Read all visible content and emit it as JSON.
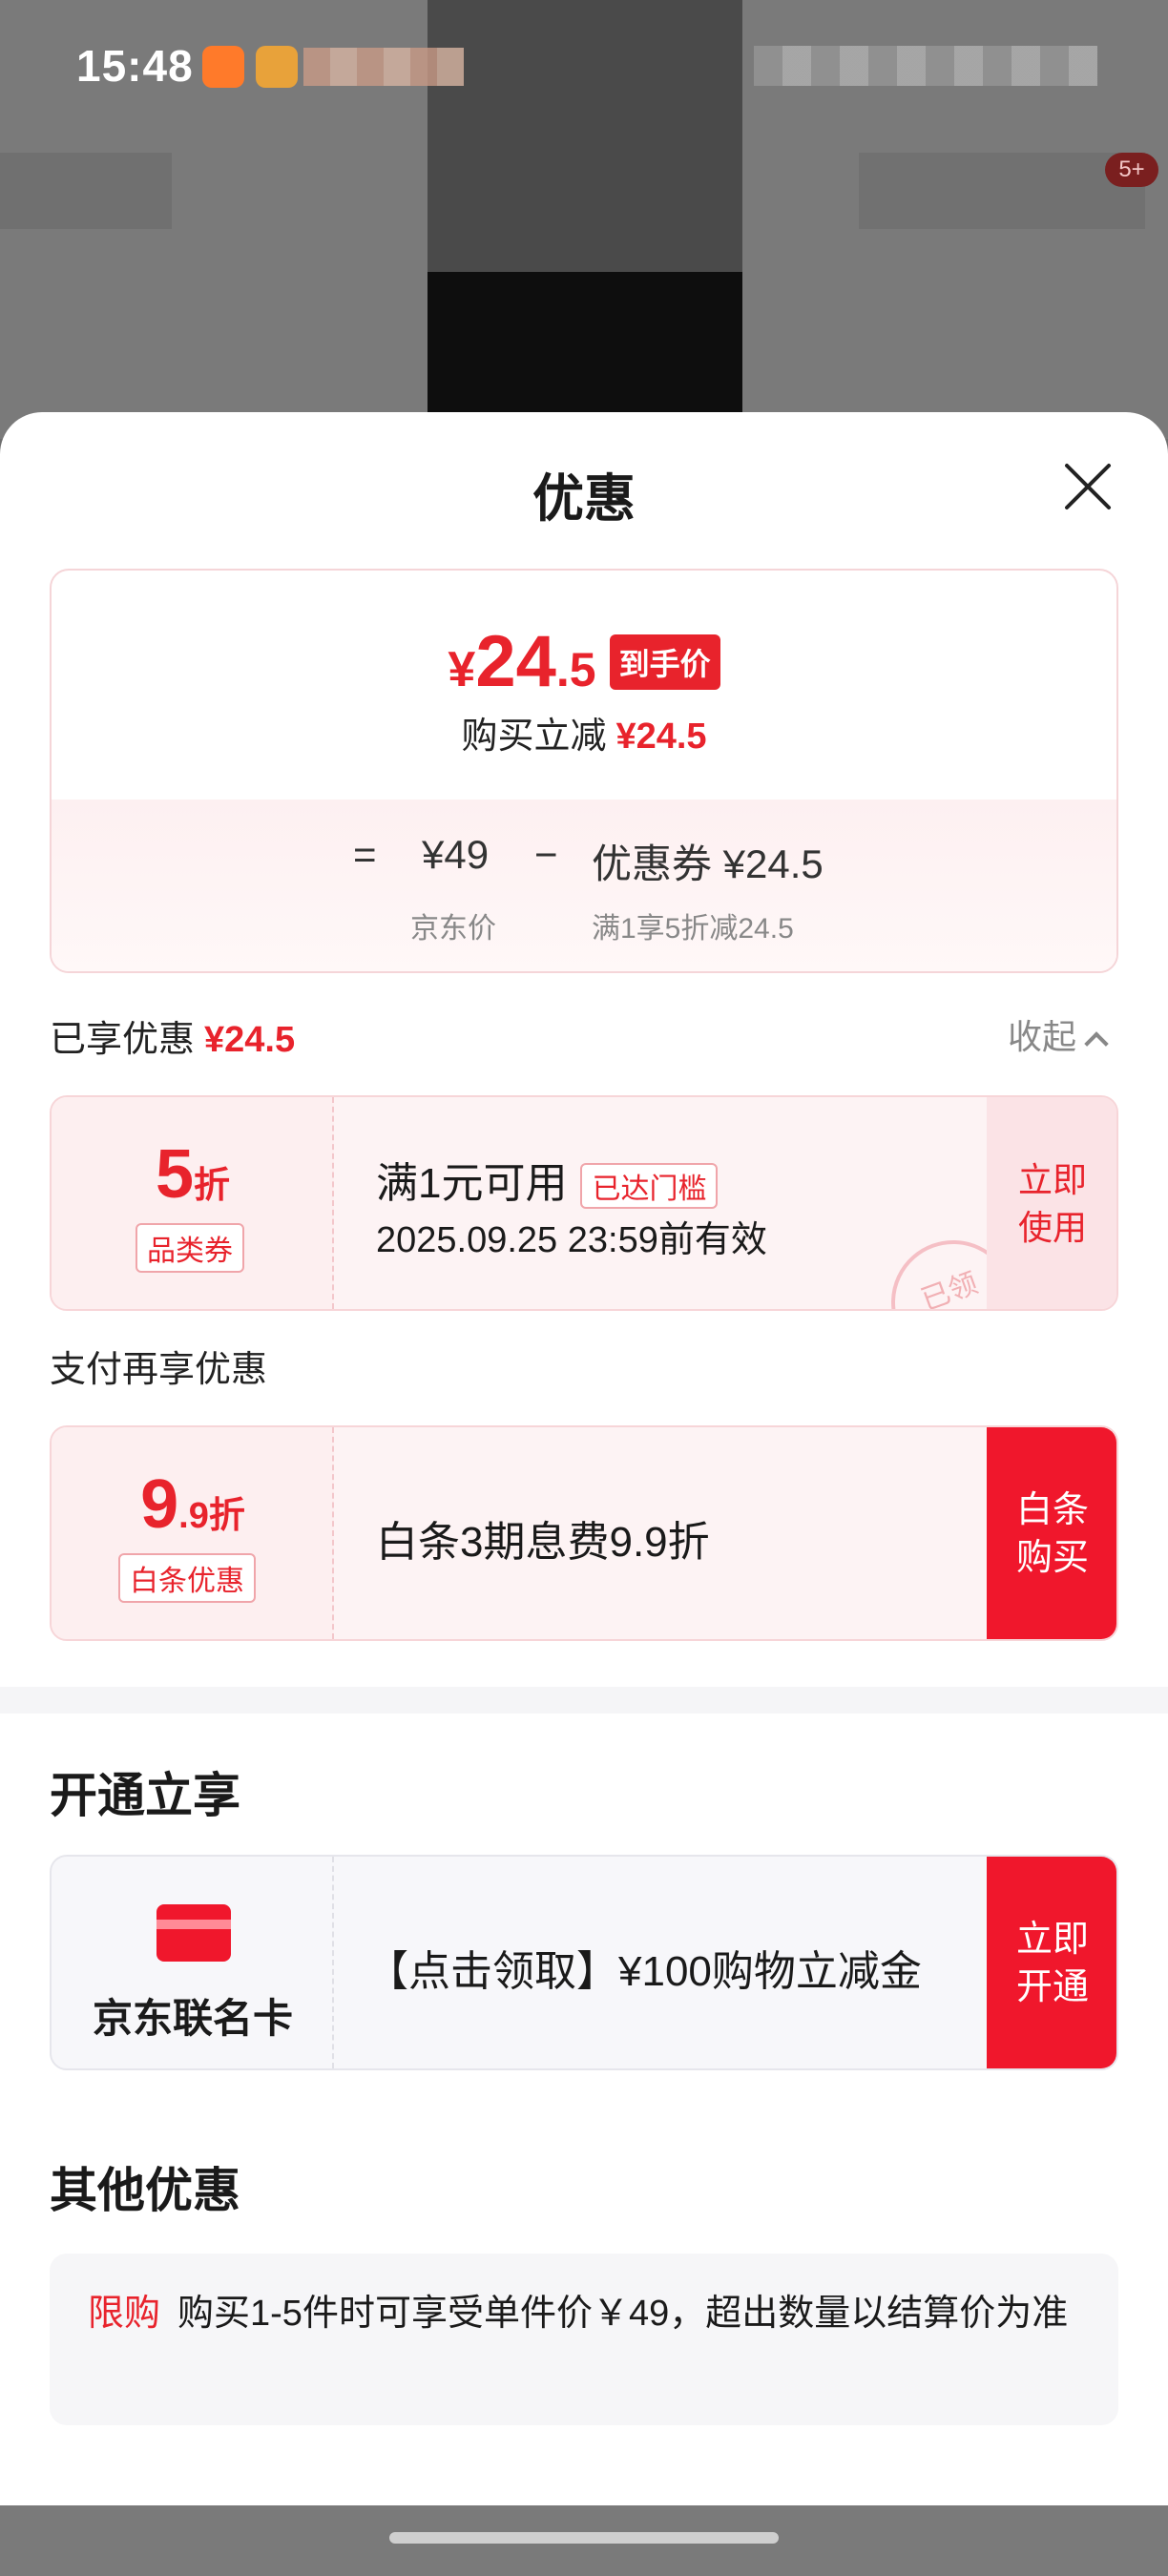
{
  "status_bar": {
    "time": "15:48",
    "notification_badge": "5+"
  },
  "sheet": {
    "title": "优惠"
  },
  "summary": {
    "price_yen": "¥",
    "price_integer": "24",
    "price_decimal": ".5",
    "price_tag": "到手价",
    "instant_label": "购买立减",
    "instant_amount": "¥24.5",
    "formula_eq": "=",
    "jd_price": "¥49",
    "formula_minus": "−",
    "coupon_text": "优惠券 ¥24.5",
    "jd_price_label": "京东价",
    "coupon_label": "满1享5折减24.5"
  },
  "enjoyed": {
    "label": "已享优惠",
    "amount": "¥24.5",
    "collapse_label": "收起"
  },
  "category_coupon": {
    "rate_big": "5",
    "rate_unit": "折",
    "type_label": "品类券",
    "condition": "满1元可用",
    "status_tag": "已达门槛",
    "validity": "2025.09.25 23:59前有效",
    "action": "立即使用",
    "stamp": "已领"
  },
  "pay_section": {
    "label": "支付再享优惠",
    "rate_big": "9",
    "rate_small": ".9折",
    "type_label": "白条优惠",
    "description": "白条3期息费9.9折",
    "action": "白条购买"
  },
  "open_section": {
    "title": "开通立享",
    "card_name": "京东联名卡",
    "description": "【点击领取】¥100购物立减金",
    "action": "立即开通",
    "icon": "credit-card-icon"
  },
  "other_section": {
    "title": "其他优惠",
    "tag": "限购",
    "text": "购买1-5件时可享受单件价￥49，超出数量以结算价为准"
  },
  "colors": {
    "accent": "#e8232c",
    "button_red": "#f0172c"
  }
}
